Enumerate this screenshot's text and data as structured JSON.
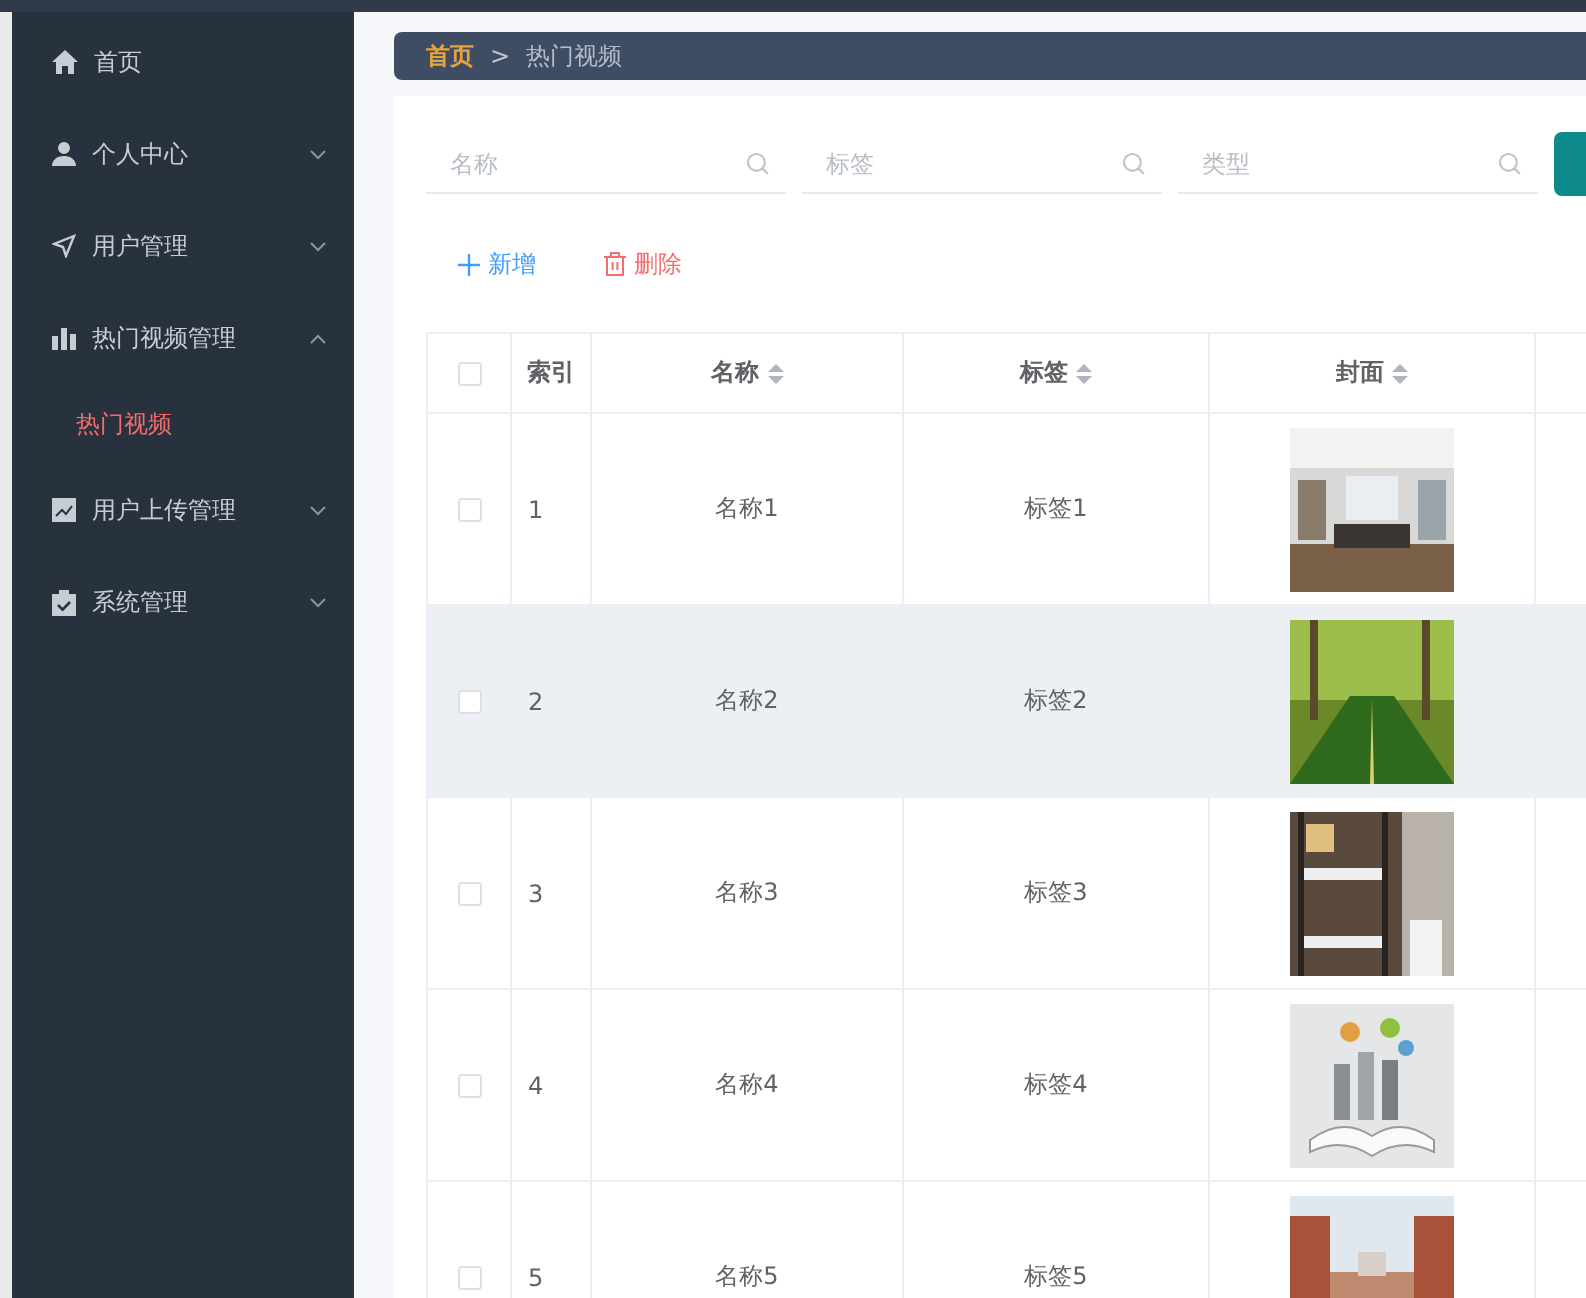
{
  "sidebar": {
    "items": [
      {
        "label": "首页"
      },
      {
        "label": "个人中心",
        "expanded": false
      },
      {
        "label": "用户管理",
        "expanded": false
      },
      {
        "label": "热门视频管理",
        "expanded": true,
        "children": [
          {
            "label": "热门视频",
            "selected": true
          }
        ]
      },
      {
        "label": "用户上传管理",
        "expanded": false
      },
      {
        "label": "系统管理",
        "expanded": false
      }
    ]
  },
  "breadcrumb": {
    "home": "首页",
    "separator": ">",
    "current": "热门视频"
  },
  "search": {
    "fields": [
      {
        "placeholder": "名称"
      },
      {
        "placeholder": "标签"
      },
      {
        "placeholder": "类型"
      }
    ]
  },
  "actions": [
    {
      "kind": "add",
      "label": "新增"
    },
    {
      "kind": "delete",
      "label": "删除"
    }
  ],
  "table": {
    "header_checked": false,
    "columns": [
      {
        "label": "索引",
        "sortable": false
      },
      {
        "label": "名称",
        "sortable": true
      },
      {
        "label": "标签",
        "sortable": true
      },
      {
        "label": "封面",
        "sortable": true
      }
    ],
    "rows": [
      {
        "checked": false,
        "hovered": false,
        "index": "1",
        "name": "名称1",
        "tag": "标签1"
      },
      {
        "checked": false,
        "hovered": true,
        "index": "2",
        "name": "名称2",
        "tag": "标签2"
      },
      {
        "checked": false,
        "hovered": false,
        "index": "3",
        "name": "名称3",
        "tag": "标签3"
      },
      {
        "checked": false,
        "hovered": false,
        "index": "4",
        "name": "名称4",
        "tag": "标签4"
      },
      {
        "checked": false,
        "hovered": false,
        "index": "5",
        "name": "名称5",
        "tag": "标签5"
      }
    ]
  }
}
